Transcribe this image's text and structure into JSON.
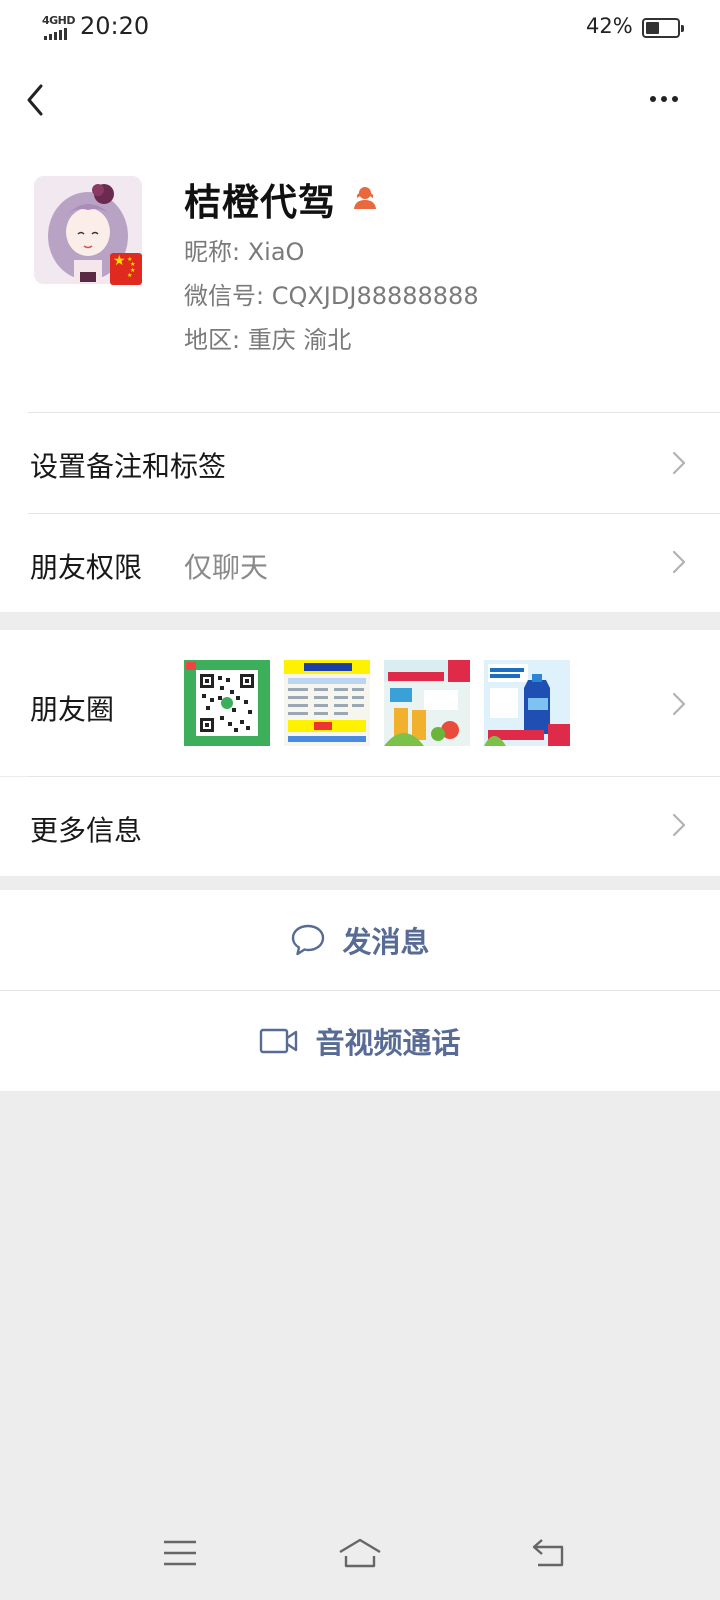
{
  "status_bar": {
    "network": "4GHD",
    "time": "20:20",
    "battery_percent": "42%",
    "battery_level": 0.42
  },
  "nav": {
    "back_icon": "chevron-left-icon",
    "more_icon": "more-dots-icon"
  },
  "profile": {
    "name": "桔橙代驾",
    "gender_icon": "female-icon",
    "nickname_line": "昵称: XiaO",
    "wechat_id_line": "微信号: CQXJDJ88888888",
    "region_line": "地区: 重庆  渝北"
  },
  "rows": {
    "remark_tags": {
      "label": "设置备注和标签"
    },
    "friend_permission": {
      "label": "朋友权限",
      "value": "仅聊天"
    },
    "moments": {
      "label": "朋友圈"
    },
    "more_info": {
      "label": "更多信息"
    }
  },
  "actions": {
    "send_message": {
      "label": "发消息",
      "icon": "chat-bubble-icon"
    },
    "video_call": {
      "label": "音视频通话",
      "icon": "video-camera-icon"
    }
  },
  "system_nav": [
    "menu-icon",
    "home-icon",
    "back-arrow-icon"
  ],
  "colors": {
    "link_blue": "#576b95",
    "gender_orange": "#e8693f",
    "background": "#ededed"
  }
}
